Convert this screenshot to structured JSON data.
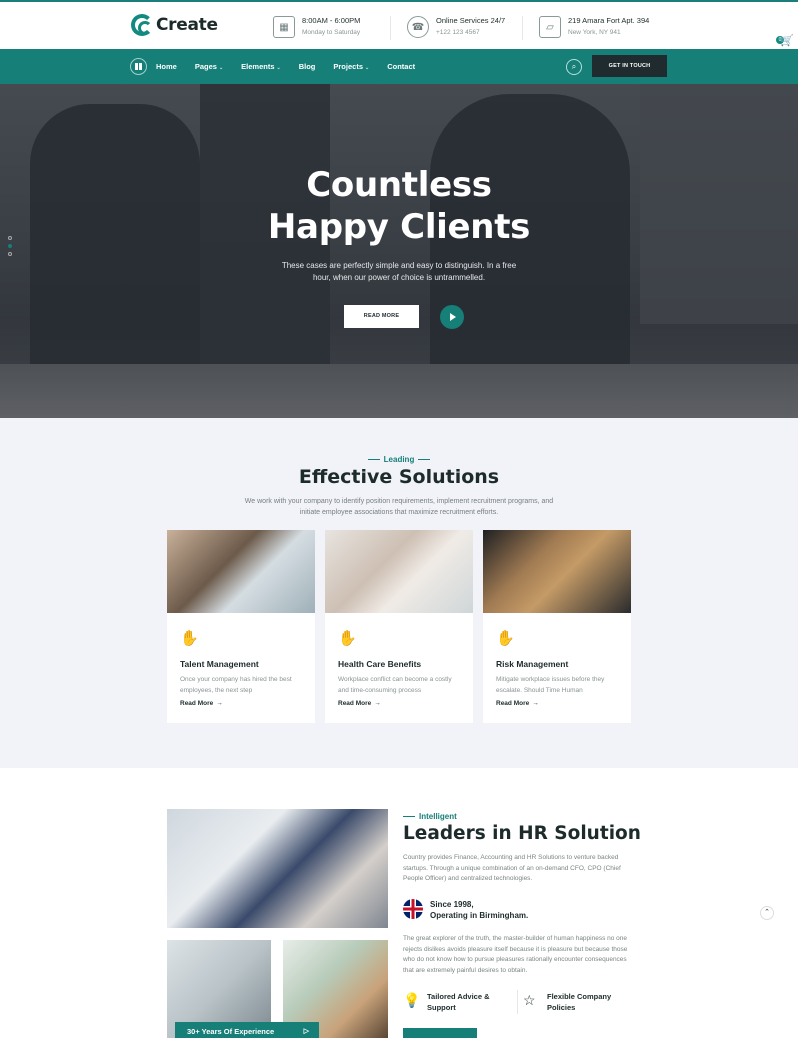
{
  "brand": {
    "name": "Create",
    "accent": "#167f78"
  },
  "topbar": {
    "hours": {
      "title": "8:00AM - 6:00PM",
      "sub": "Monday to Saturday",
      "icon": "calendar-icon"
    },
    "services": {
      "title": "Online Services 24/7",
      "sub": "+122 123 4567",
      "icon": "support-24-icon"
    },
    "address": {
      "title": "219 Amara Fort Apt. 394",
      "sub": "New York, NY 941",
      "icon": "map-icon"
    },
    "cart_count": "0"
  },
  "nav": {
    "items": [
      {
        "label": "Home",
        "dropdown": false
      },
      {
        "label": "Pages",
        "dropdown": true
      },
      {
        "label": "Elements",
        "dropdown": true
      },
      {
        "label": "Blog",
        "dropdown": false
      },
      {
        "label": "Projects",
        "dropdown": true
      },
      {
        "label": "Contact",
        "dropdown": false
      }
    ],
    "cta": "GET IN TOUCH"
  },
  "hero": {
    "title_line1": "Countless",
    "title_line2": "Happy Clients",
    "subtitle": "These cases are perfectly simple and easy to distinguish. In a free hour, when our power of choice is untrammelled.",
    "button": "READ MORE"
  },
  "solutions": {
    "eyebrow": "Leading",
    "title": "Effective Solutions",
    "description": "We work with your company to identify position requirements, implement recruitment programs, and initiate employee associations that maximize recruitment efforts.",
    "cards": [
      {
        "title": "Talent Management",
        "desc": "Once your company has hired the best employees, the next step",
        "more": "Read More"
      },
      {
        "title": "Health Care Benefits",
        "desc": "Workplace conflict can become a costly and time-consuming process",
        "more": "Read More"
      },
      {
        "title": "Risk Management",
        "desc": "Mitigate workplace issues before they escalate. Should Time Human",
        "more": "Read More"
      }
    ]
  },
  "hr": {
    "eyebrow": "Intelligent",
    "title": "Leaders in HR Solution",
    "description": "Country provides Finance, Accounting and HR Solutions to venture backed startups. Through a unique combination of an on-demand CFO, CPO (Chief People Officer) and centralized technologies.",
    "since_line1": "Since 1998,",
    "since_line2": "Operating in Birmingham.",
    "description2": "The great explorer of the truth, the master-builder of human happiness no one rejects dislikes avoids pleasure itself because it is pleasure but because those who do not know how to pursue pleasures rationally encounter consequences that are extremely painful desires to obtain.",
    "features": [
      {
        "line1": "Tailored Advice &",
        "line2": "Support",
        "icon": "lightbulb-icon"
      },
      {
        "line1": "Flexible Company",
        "line2": "Policies",
        "icon": "star-icon"
      }
    ],
    "experience": "30+ Years Of Experience"
  }
}
